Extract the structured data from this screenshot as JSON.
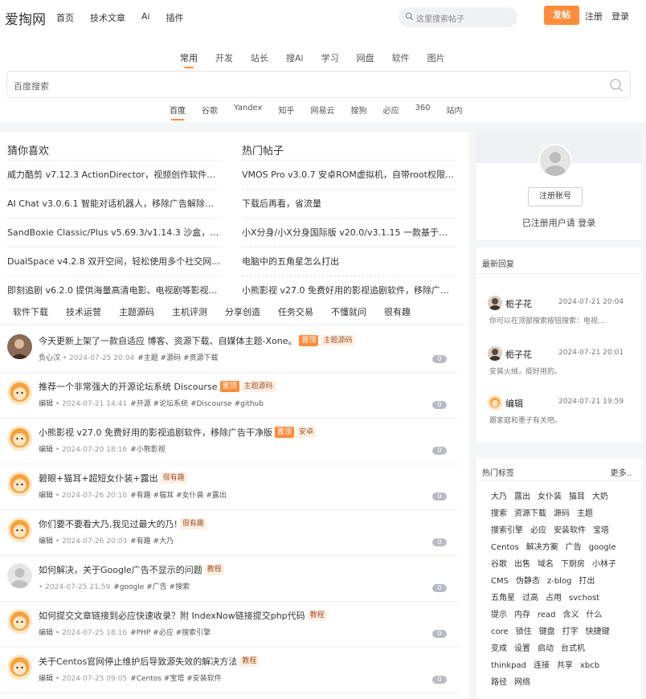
{
  "header": {
    "logo": "爱掏网",
    "nav": [
      "首页",
      "技术文章",
      "Ai",
      "插件"
    ],
    "search_placeholder": "这里搜索帖子",
    "post_button": "发帖",
    "register": "注册",
    "login": "登录"
  },
  "search_panel": {
    "tabs": [
      "常用",
      "开发",
      "站长",
      "搜Ai",
      "学习",
      "网盘",
      "软件",
      "图片"
    ],
    "placeholder": "百度搜索",
    "engines": [
      "百度",
      "谷歌",
      "Yandex",
      "知乎",
      "网易云",
      "搜狗",
      "必应",
      "360",
      "站内"
    ]
  },
  "guess": {
    "title": "猜你喜欢",
    "items": [
      "威力酷剪 v7.12.3 ActionDirector，视频创作软件，…",
      "AI Chat v3.0.6.1 智能对话机器人，移除广告解除高级版",
      "SandBoxie Classic/Plus v5.69.3/v1.14.3 沙盒，知名…",
      "DualSpace v4.2.8 双开空间，轻松使用多个社交网络…",
      "即刻追剧 v6.2.0 提供海量高清电影、电视剧等影视，…"
    ]
  },
  "hot": {
    "title": "热门帖子",
    "items": [
      "VMOS Pro v3.0.7 安卓ROM虚拟机，自带root权限，…",
      "下载后再看，省流量",
      "小X分身/小X分身国际版 v20.0/v3.1.15 一款基于安卓…",
      "电脑中的五角星怎么打出",
      "小熊影视 v27.0 免费好用的影视追剧软件，移除广告…"
    ]
  },
  "categories": [
    "软件下载",
    "技术运营",
    "主题源码",
    "主机评测",
    "分享创造",
    "任务交易",
    "不懂就问",
    "很有趣"
  ],
  "posts": [
    {
      "title": "今天更新上架了一款自适应 博客、资源下载、自媒体主题-Xone。",
      "badges": [
        "置顶",
        "主题源码"
      ],
      "author": "负心汉",
      "date": "2024-07-25 20:04",
      "tags": "#主题 #源码 #资源下载",
      "count": "0"
    },
    {
      "title": "推荐一个非常强大的开源论坛系统 Discourse",
      "badges": [
        "置顶",
        "主题源码"
      ],
      "author": "编辑",
      "date": "2024-07-21 14:41",
      "tags": "#开源 #论坛系统 #Discourse #github",
      "count": "0"
    },
    {
      "title": "小熊影视 v27.0 免费好用的影视追剧软件，移除广告干净版",
      "badges": [
        "置顶",
        "安卓"
      ],
      "author": "编辑",
      "date": "2024-07-20 18:16",
      "tags": "#小熊影视",
      "count": "0"
    },
    {
      "title": "碧眼+猫耳+超短女仆装+露出",
      "badges": [
        "很有趣"
      ],
      "author": "编辑",
      "date": "2024-07-26 20:10",
      "tags": "#有趣 #猫耳 #女仆装 #露出",
      "count": "0"
    },
    {
      "title": "你们要不要看大乃,我见过最大的乃!",
      "badges": [
        "很有趣"
      ],
      "author": "编辑",
      "date": "2024-07-26 20:03",
      "tags": "#有趣 #大乃",
      "count": "0"
    },
    {
      "title": "如何解决，关于Google广告不显示的问题",
      "badges": [
        "教程"
      ],
      "author": "",
      "date": "2024-07-25 21:59",
      "tags": "#google #广告 #搜索",
      "count": "0"
    },
    {
      "title": "如何提交文章链接到必应快速收录？附 IndexNow链接提交php代码",
      "badges": [
        "教程"
      ],
      "author": "编辑",
      "date": "2024-07-25 18:16",
      "tags": "#PHP #必应 #搜索引擎",
      "count": "0"
    },
    {
      "title": "关于Centos官网停止维护后导致源失效的解决方法",
      "badges": [
        "教程"
      ],
      "author": "编辑",
      "date": "2024-07-25 09:05",
      "tags": "#Centos #宝塔 #安装软件",
      "count": "0"
    }
  ],
  "profile": {
    "register_button": "注册账号",
    "hint": "已注册用户请 登录"
  },
  "replies": {
    "title": "最新回复",
    "items": [
      {
        "name": "栀子花",
        "time": "2024-07-21 20:04",
        "content": "你可以在顶部搜索按钮搜索：电视…"
      },
      {
        "name": "栀子花",
        "time": "2024-07-21 20:01",
        "content": "安装火绒，挺好用的。"
      },
      {
        "name": "编辑",
        "time": "2024-07-21 19:59",
        "content": "跟家庭和墨子有关吧。"
      }
    ]
  },
  "hot_tags": {
    "title": "热门标签",
    "more": "更多..",
    "tags": [
      "大乃",
      "露出",
      "女仆装",
      "猫耳",
      "大奶",
      "搜索",
      "资源下载",
      "源码",
      "主题",
      "搜索引擎",
      "必应",
      "安装软件",
      "宝塔",
      "Centos",
      "解决方案",
      "广告",
      "google",
      "谷歌",
      "出售",
      "域名",
      "下厨房",
      "小林子",
      "CMS",
      "伪静态",
      "z-blog",
      "打出",
      "五角星",
      "过高",
      "占用",
      "svchost",
      "提示",
      "内存",
      "read",
      "含义",
      "什么",
      "core",
      "锁住",
      "键盘",
      "打字",
      "快捷键",
      "变成",
      "设置",
      "启动",
      "台式机",
      "thinkpad",
      "连接",
      "共享",
      "xbcb",
      "路径",
      "网络"
    ]
  },
  "colors": {
    "accent": "#ff8c3b",
    "badge_tag_bg": "#fdf0e2"
  }
}
